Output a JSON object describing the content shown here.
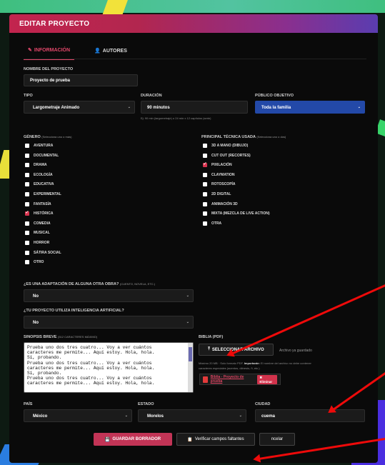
{
  "header": {
    "title": "EDITAR PROYECTO"
  },
  "tabs": [
    {
      "label": "INFORMACIÓN",
      "icon": "edit-icon",
      "active": true
    },
    {
      "label": "AUTORES",
      "icon": "user-icon",
      "active": false
    }
  ],
  "form": {
    "nombre": {
      "label": "NOMBRE DEL PROYECTO",
      "value": "Proyecto de prueba"
    },
    "tipo": {
      "label": "TIPO",
      "value": "Largometraje Animado"
    },
    "duracion": {
      "label": "DURACIÓN",
      "value": "90 minutos",
      "hint": "Ej: 90 min (largometraje) o 24 min x 12 capítulos (serie)"
    },
    "publico": {
      "label": "PÚBLICO OBJETIVO",
      "value": "Toda la familia"
    },
    "genero": {
      "label": "GÉNERO",
      "note": "(Selecciona uno o más)",
      "options": [
        {
          "label": "AVENTURA",
          "checked": false
        },
        {
          "label": "DOCUMENTAL",
          "checked": false
        },
        {
          "label": "DRAMA",
          "checked": false
        },
        {
          "label": "ECOLOGÍA",
          "checked": false
        },
        {
          "label": "EDUCATIVA",
          "checked": false
        },
        {
          "label": "EXPERIMENTAL",
          "checked": false
        },
        {
          "label": "FANTASÍA",
          "checked": false
        },
        {
          "label": "HISTÓRICA",
          "checked": true
        },
        {
          "label": "COMEDIA",
          "checked": false
        },
        {
          "label": "MUSICAL",
          "checked": false
        },
        {
          "label": "HORROR",
          "checked": false
        },
        {
          "label": "SÁTIRA SOCIAL",
          "checked": false
        },
        {
          "label": "OTRO",
          "checked": false
        }
      ]
    },
    "tecnica": {
      "label": "PRINCIPAL TÉCNICA USADA",
      "note": "(Selecciona uno o dos)",
      "options": [
        {
          "label": "3D A MANO (DIBUJO)",
          "checked": false
        },
        {
          "label": "CUT OUT (RECORTES)",
          "checked": false
        },
        {
          "label": "PIXILACIÓN",
          "checked": true
        },
        {
          "label": "CLAYMATION",
          "checked": false
        },
        {
          "label": "ROTOSCOPÍA",
          "checked": false
        },
        {
          "label": "2D DIGITAL",
          "checked": false
        },
        {
          "label": "ANIMACIÓN 3D",
          "checked": false
        },
        {
          "label": "MIXTA (MEZCLA DE LIVE ACTION)",
          "checked": false
        },
        {
          "label": "OTRA",
          "checked": false
        }
      ]
    },
    "adaptacion": {
      "label": "¿ES UNA ADAPTACIÓN DE ALGUNA OTRA OBRA?",
      "note": "(CUENTO, NOVELA, ETC.)",
      "value": "No"
    },
    "ia": {
      "label": "¿TU PROYECTO UTILIZA INTELIGENCIA ARTIFICIAL?",
      "value": "No"
    },
    "sinopsis": {
      "label": "SINOPSIS BREVE",
      "note": "(512 CARACTERES MÁXIMO)",
      "value": "Prueba uno dos tres cuatro... Voy a ver cuántos\ncaracteres me permite... Aquí estoy. Hola, hola.\nSí, probando.\nPrueba uno dos tres cuatro... Voy a ver cuántos\ncaracteres me permite... Aquí estoy. Hola, hola.\nSí, probando.\nPrueba uno dos tres cuatro... Voy a ver cuántos\ncaracteres me permite... Aquí estoy. Hola, hola."
    },
    "biblia": {
      "label": "BIBLIA (PDF)",
      "button": "SELECCIONAR ARCHIVO",
      "status": "Archivo ya guardado",
      "hint_a": "Máximo 20 MB · Solo formato PDF.",
      "hint_strong": "Importante:",
      "hint_b": "El nombre del archivo no debe contener",
      "hint_c": "caracteres especiales (acentos, diéresis, ñ, etc.)",
      "file_name": "Biblia - Proyecto de prueba",
      "delete_label": "✖ Eliminar"
    },
    "pais": {
      "label": "PAÍS",
      "value": "México"
    },
    "estado": {
      "label": "ESTADO",
      "value": "Morelos"
    },
    "ciudad": {
      "label": "CIUDAD",
      "value": "cuema"
    }
  },
  "footer": {
    "save_label": "GUARDAR BORRADOR",
    "verify_label": "Verificar campos faltantes",
    "cancel_label": "ncelar"
  }
}
